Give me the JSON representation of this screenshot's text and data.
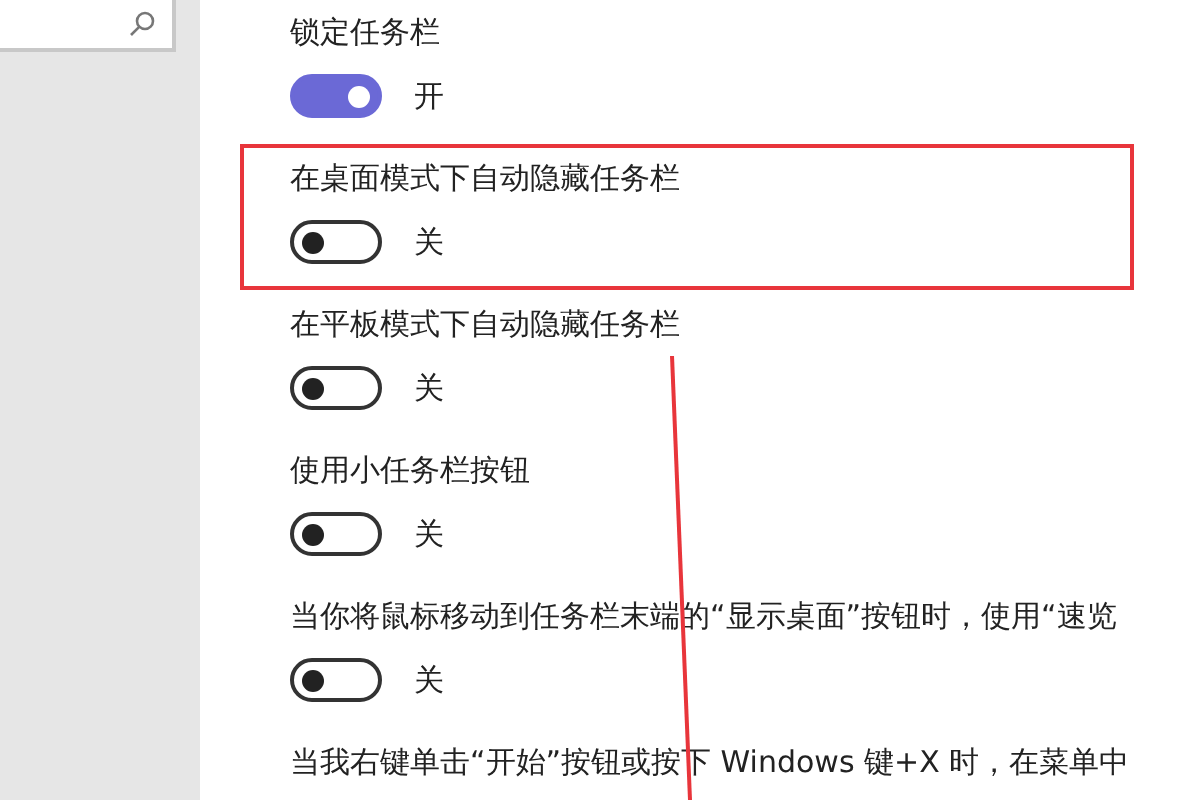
{
  "settings": [
    {
      "label": "锁定任务栏",
      "on": true,
      "state_text": "开",
      "highlighted": false
    },
    {
      "label": "在桌面模式下自动隐藏任务栏",
      "on": false,
      "state_text": "关",
      "highlighted": true
    },
    {
      "label": "在平板模式下自动隐藏任务栏",
      "on": false,
      "state_text": "关",
      "highlighted": false
    },
    {
      "label": "使用小任务栏按钮",
      "on": false,
      "state_text": "关",
      "highlighted": false
    },
    {
      "label": "当你将鼠标移动到任务栏末端的“显示桌面”按钮时，使用“速览",
      "on": false,
      "state_text": "关",
      "highlighted": false
    },
    {
      "label": "当我右键单击“开始”按钮或按下 Windows 键+X 时，在菜单中",
      "highlighted": false
    }
  ]
}
